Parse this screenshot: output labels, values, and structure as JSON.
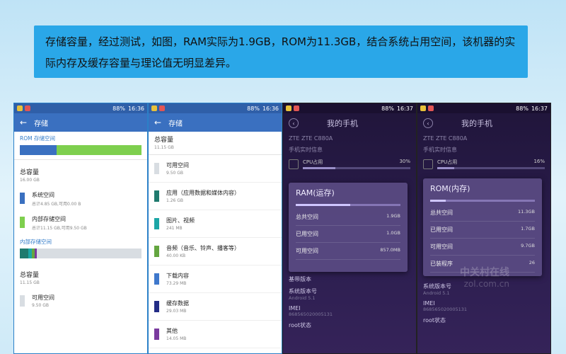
{
  "caption": "存储容量，经过测试，如图，RAM实际为1.9GB，ROM为11.3GB，结合系统占用空间，该机器的实际内存及缓存容量与理论值无明显差异。",
  "status": {
    "time1": "16:36",
    "time2": "16:36",
    "time3": "16:37",
    "time4": "16:37",
    "battery": "88%"
  },
  "screen1": {
    "title": "存储",
    "rom_label": "ROM 存储空间",
    "total_label": "总容量",
    "total_value": "16.00 GB",
    "system_label": "系统空间",
    "system_sub": "总计4.85 GB,可用0.00 B",
    "internal_label": "内部存储空间",
    "internal_sub": "总计11.15 GB,可用9.50 GB",
    "internal_section": "内部存储空间",
    "total2_label": "总容量",
    "total2_value": "11.15 GB",
    "avail_label": "可用空间",
    "avail_value": "9.50 GB"
  },
  "screen2": {
    "title": "存储",
    "total_label": "总容量",
    "total_value": "11.15 GB",
    "items": [
      {
        "label": "可用空间",
        "value": "9.50 GB",
        "color": "#d8dde2"
      },
      {
        "label": "应用（应用数据和媒体内容）",
        "value": "1.26 GB",
        "color": "#1f7a6e"
      },
      {
        "label": "图片、视频",
        "value": "241 MB",
        "color": "#1ca6a6"
      },
      {
        "label": "音频（音乐、铃声、播客等）",
        "value": "40.00 KB",
        "color": "#64a640"
      },
      {
        "label": "下载内容",
        "value": "73.29 MB",
        "color": "#3f78cc"
      },
      {
        "label": "缓存数据",
        "value": "29.03 MB",
        "color": "#232c86"
      },
      {
        "label": "其他",
        "value": "14.05 MB",
        "color": "#7a3a9e"
      }
    ]
  },
  "screen3": {
    "header": "我的手机",
    "model": "ZTE ZTE C880A",
    "realtime": "手机实时信息",
    "cpu_label": "CPU占用",
    "cpu_value": "30%",
    "popup_title": "RAM(运存)",
    "rows": [
      {
        "label": "总共空间",
        "value": "1.9GB"
      },
      {
        "label": "已用空间",
        "value": "1.0GB"
      },
      {
        "label": "可用空间",
        "value": "857.0MB"
      }
    ],
    "lower": [
      {
        "label": "基带版本",
        "value": ""
      },
      {
        "label": "系统版本号",
        "value": "Android 5.1"
      },
      {
        "label": "IMEI",
        "value": "868565020005131"
      },
      {
        "label": "root状态",
        "value": ""
      }
    ]
  },
  "screen4": {
    "header": "我的手机",
    "model": "ZTE ZTE C880A",
    "realtime": "手机实时信息",
    "cpu_label": "CPU占用",
    "cpu_value": "16%",
    "popup_title": "ROM(内存)",
    "rows": [
      {
        "label": "总共空间",
        "value": "11.3GB"
      },
      {
        "label": "已用空间",
        "value": "1.7GB"
      },
      {
        "label": "可用空间",
        "value": "9.7GB"
      },
      {
        "label": "已装程序",
        "value": "26"
      }
    ],
    "lower": [
      {
        "label": "系统版本号",
        "value": "Android 5.1"
      },
      {
        "label": "IMEI",
        "value": "868565020005131"
      },
      {
        "label": "root状态",
        "value": ""
      }
    ],
    "watermark": "中关村在线",
    "watermark2": "zol.com.cn"
  }
}
